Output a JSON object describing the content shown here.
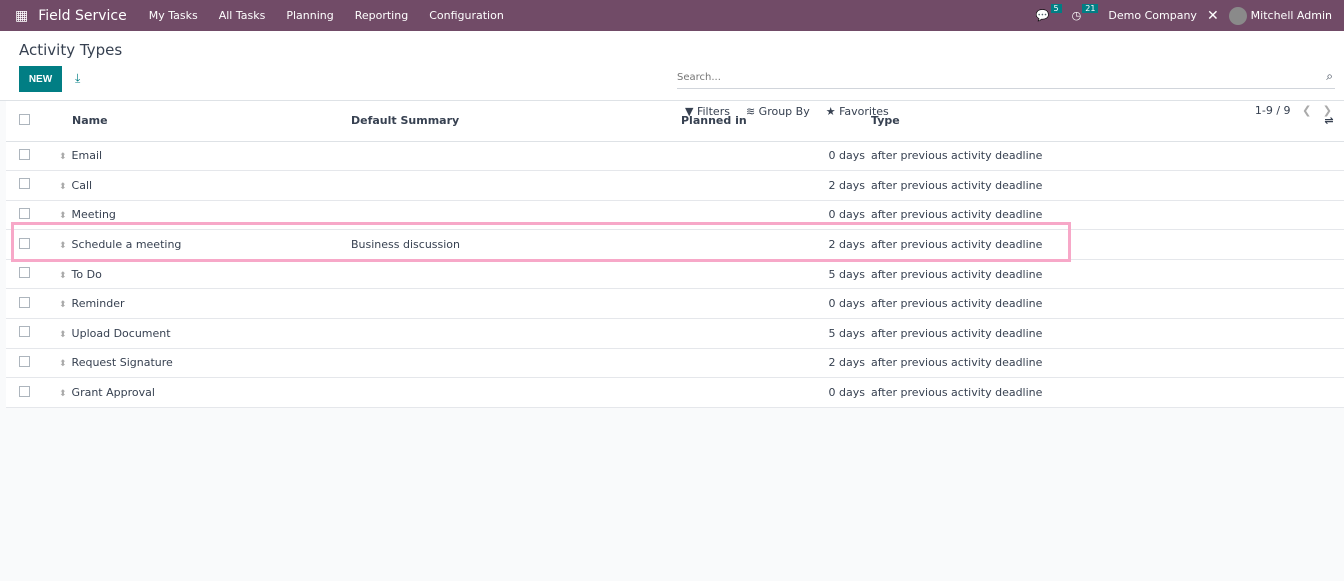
{
  "nav": {
    "app": "Field Service",
    "menu": [
      "My Tasks",
      "All Tasks",
      "Planning",
      "Reporting",
      "Configuration"
    ],
    "messages_count": "5",
    "activities_count": "21",
    "company": "Demo Company",
    "user": "Mitchell Admin"
  },
  "control": {
    "title": "Activity Types",
    "new_label": "NEW",
    "search_placeholder": "Search...",
    "filters": "Filters",
    "group_by": "Group By",
    "favorites": "Favorites",
    "pager": "1-9 / 9"
  },
  "columns": {
    "name": "Name",
    "summary": "Default Summary",
    "planned": "Planned in",
    "type": "Type"
  },
  "rows": [
    {
      "name": "Email",
      "summary": "",
      "planned": "0 days",
      "type": "after previous activity deadline"
    },
    {
      "name": "Call",
      "summary": "",
      "planned": "2 days",
      "type": "after previous activity deadline"
    },
    {
      "name": "Meeting",
      "summary": "",
      "planned": "0 days",
      "type": "after previous activity deadline"
    },
    {
      "name": "Schedule a meeting",
      "summary": "Business discussion",
      "planned": "2 days",
      "type": "after previous activity deadline"
    },
    {
      "name": "To Do",
      "summary": "",
      "planned": "5 days",
      "type": "after previous activity deadline"
    },
    {
      "name": "Reminder",
      "summary": "",
      "planned": "0 days",
      "type": "after previous activity deadline"
    },
    {
      "name": "Upload Document",
      "summary": "",
      "planned": "5 days",
      "type": "after previous activity deadline"
    },
    {
      "name": "Request Signature",
      "summary": "",
      "planned": "2 days",
      "type": "after previous activity deadline"
    },
    {
      "name": "Grant Approval",
      "summary": "",
      "planned": "0 days",
      "type": "after previous activity deadline"
    }
  ],
  "colors": {
    "navbar": "#714b67",
    "primary": "#017e84",
    "highlight": "#f7a8c8"
  }
}
